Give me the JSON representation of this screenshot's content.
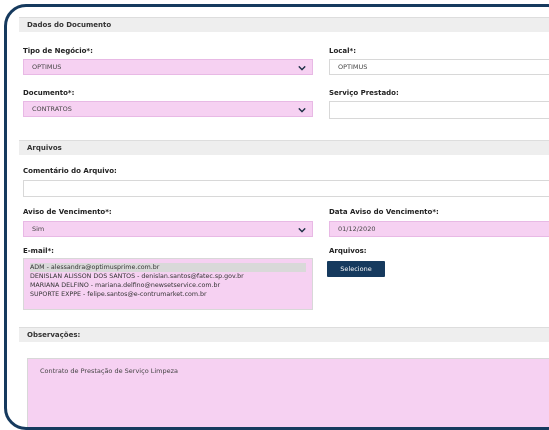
{
  "sections": {
    "document_data": "Dados do Documento",
    "files": "Arquivos",
    "observations": "Observações:"
  },
  "form": {
    "business_type": {
      "label": "Tipo de Negócio*:",
      "value": "OPTIMUS"
    },
    "local": {
      "label": "Local*:",
      "value": "OPTIMUS"
    },
    "document": {
      "label": "Documento*:",
      "value": "CONTRATOS"
    },
    "service": {
      "label": "Serviço Prestado:",
      "value": ""
    },
    "file_comment": {
      "label": "Comentário do Arquivo:",
      "value": ""
    },
    "expiry_notice": {
      "label": "Aviso de Vencimento*:",
      "value": "Sim"
    },
    "expiry_date": {
      "label": "Data Aviso do Vencimento*:",
      "value": "01/12/2020"
    },
    "email": {
      "label": "E-mail*:",
      "options": [
        "ADM - alessandra@optimusprime.com.br",
        "DENISLAN ALISSON DOS SANTOS - denislan.santos@fatec.sp.gov.br",
        "MARIANA DELFINO - mariana.delfino@newsetservice.com.br",
        "SUPORTE EXPPE - felipe.santos@e-contrumarket.com.br"
      ],
      "selected_index": 0
    },
    "attachments": {
      "label": "Arquivos:",
      "button": "Selecione"
    },
    "observations_text": "Contrato de Prestação de Serviço Limpeza"
  },
  "icons": {
    "select_arrow": "chevron-down-icon"
  },
  "colors": {
    "brand": "#163a5e",
    "required_fill": "#f6d1f2"
  }
}
